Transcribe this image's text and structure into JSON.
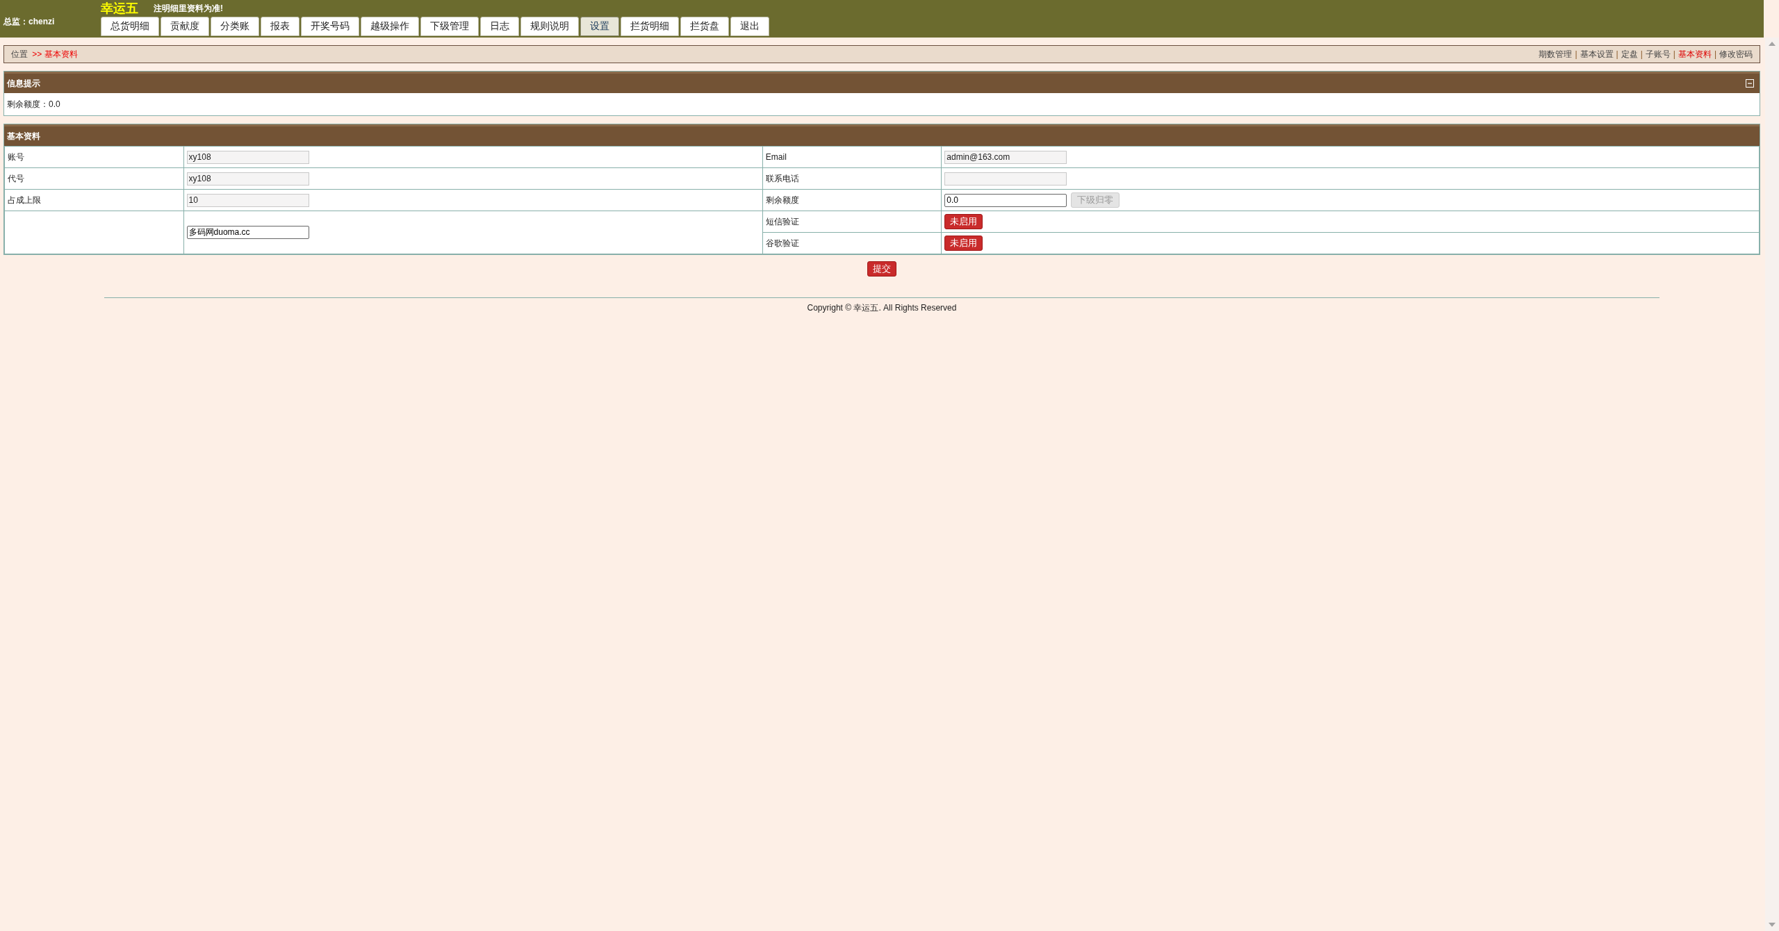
{
  "header": {
    "user_label": "总监：",
    "user_name": "chenzi",
    "logo": "幸运五",
    "notice": "注明细里资料为准!"
  },
  "tabs": [
    {
      "label": "总货明细",
      "selected": false
    },
    {
      "label": "贡献度",
      "selected": false
    },
    {
      "label": "分类账",
      "selected": false
    },
    {
      "label": "报表",
      "selected": false
    },
    {
      "label": "开奖号码",
      "selected": false
    },
    {
      "label": "越级操作",
      "selected": false
    },
    {
      "label": "下级管理",
      "selected": false
    },
    {
      "label": "日志",
      "selected": false
    },
    {
      "label": "规则说明",
      "selected": false
    },
    {
      "label": "设置",
      "selected": true
    },
    {
      "label": "拦货明细",
      "selected": false
    },
    {
      "label": "拦货盘",
      "selected": false
    },
    {
      "label": "退出",
      "selected": false
    }
  ],
  "breadcrumb": {
    "position": "位置",
    "current": ">> 基本资料",
    "separator": "|",
    "links": [
      {
        "label": "期数管理",
        "selected": false
      },
      {
        "label": "基本设置",
        "selected": false
      },
      {
        "label": "定盘",
        "selected": false
      },
      {
        "label": "子账号",
        "selected": false
      },
      {
        "label": "基本资料",
        "selected": true
      },
      {
        "label": "修改密码",
        "selected": false
      }
    ]
  },
  "info_panel": {
    "title": "信息提示",
    "expanded": true,
    "text": "剩余额度：0.0"
  },
  "basic_panel": {
    "title": "基本资料",
    "left": [
      {
        "label": "账号",
        "field": {
          "kind": "readonly",
          "value": "xy108"
        }
      },
      {
        "label": "代号",
        "field": {
          "kind": "readonly",
          "value": "xy108"
        }
      },
      {
        "label": "占成上限",
        "field": {
          "kind": "readonly",
          "value": "10"
        }
      },
      {
        "field": {
          "kind": "input",
          "value": "多码网duoma.cc"
        }
      }
    ],
    "right": [
      {
        "label": "Email",
        "field": {
          "kind": "readonly",
          "value": "admin@163.com"
        }
      },
      {
        "label": "联系电话",
        "field": {
          "kind": "readonly"
        }
      },
      {
        "label": "剩余额度",
        "field": {
          "kind": "input",
          "value": "0.0",
          "action": {
            "label": "下级归零",
            "disabled": true
          }
        }
      },
      {
        "label": "短信验证",
        "field": {
          "kind": "button",
          "value": "未启用"
        }
      },
      {
        "label": "谷歌验证",
        "field": {
          "kind": "button",
          "value": "未启用"
        }
      }
    ]
  },
  "submit": "提交",
  "footer": "Copyright © 幸运五. All Rights Reserved"
}
